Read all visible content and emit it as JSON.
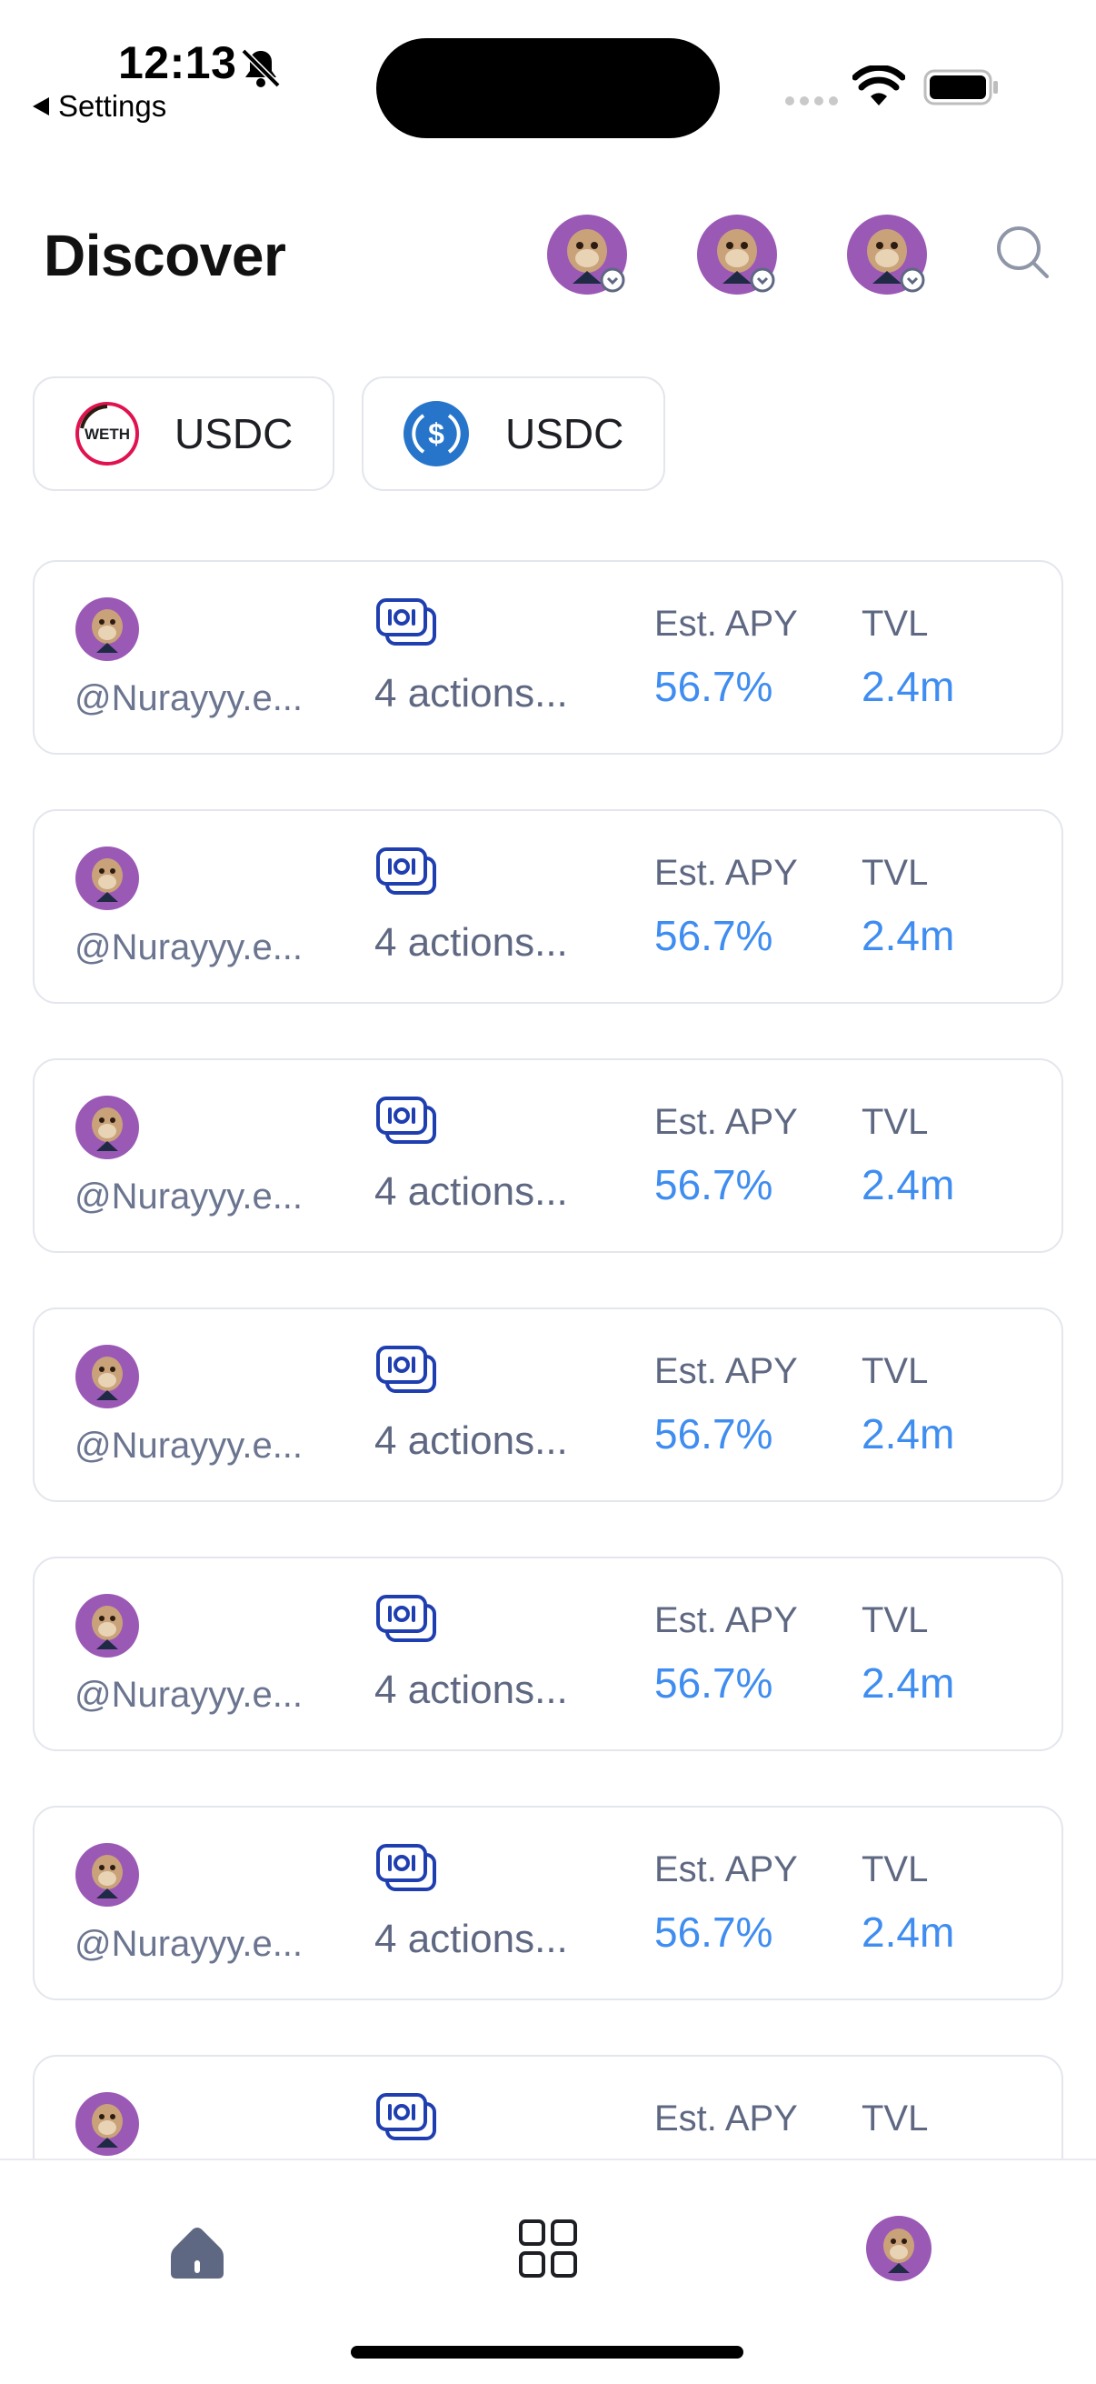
{
  "status_bar": {
    "time": "12:13",
    "back_label": "Settings"
  },
  "header": {
    "title": "Discover"
  },
  "chips": [
    {
      "logo_text": "WETH",
      "label": "USDC"
    },
    {
      "logo_text": "$",
      "label": "USDC"
    }
  ],
  "cards": [
    {
      "handle": "@Nurayyy.e...",
      "actions": "4 actions...",
      "apy_label": "Est. APY",
      "apy": "56.7%",
      "tvl_label": "TVL",
      "tvl": "2.4m"
    },
    {
      "handle": "@Nurayyy.e...",
      "actions": "4 actions...",
      "apy_label": "Est. APY",
      "apy": "56.7%",
      "tvl_label": "TVL",
      "tvl": "2.4m"
    },
    {
      "handle": "@Nurayyy.e...",
      "actions": "4 actions...",
      "apy_label": "Est. APY",
      "apy": "56.7%",
      "tvl_label": "TVL",
      "tvl": "2.4m"
    },
    {
      "handle": "@Nurayyy.e...",
      "actions": "4 actions...",
      "apy_label": "Est. APY",
      "apy": "56.7%",
      "tvl_label": "TVL",
      "tvl": "2.4m"
    },
    {
      "handle": "@Nurayyy.e...",
      "actions": "4 actions...",
      "apy_label": "Est. APY",
      "apy": "56.7%",
      "tvl_label": "TVL",
      "tvl": "2.4m"
    },
    {
      "handle": "@Nurayyy.e...",
      "actions": "4 actions...",
      "apy_label": "Est. APY",
      "apy": "56.7%",
      "tvl_label": "TVL",
      "tvl": "2.4m"
    },
    {
      "handle": "",
      "actions": "",
      "apy_label": "Est. APY",
      "apy": "",
      "tvl_label": "TVL",
      "tvl": ""
    }
  ],
  "tabbar": {
    "tabs": [
      "home-icon",
      "grid-icon",
      "profile-avatar"
    ]
  },
  "colors": {
    "accent_blue": "#3f8df0",
    "muted_text": "#5f6882",
    "avatar_purple": "#9b59b6",
    "usdc_blue": "#2775ca",
    "weth_red": "#e0124f"
  }
}
